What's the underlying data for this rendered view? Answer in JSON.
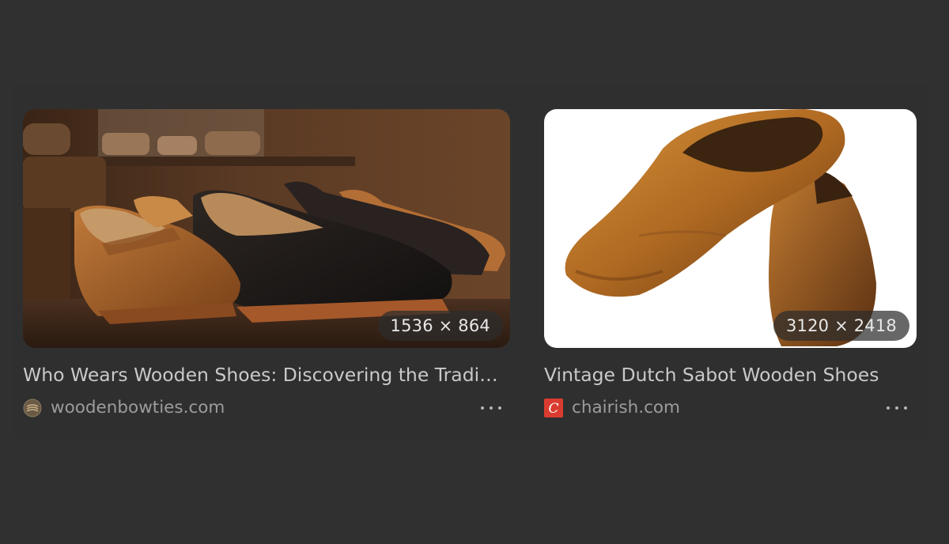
{
  "results": [
    {
      "title": "Who Wears Wooden Shoes: Discovering the Traditions",
      "dimensions": "1536 × 864",
      "source": "woodenbowties.com",
      "favicon": "woodenbowties-favicon-icon",
      "image": "wooden-clogs-row-on-shelf-image"
    },
    {
      "title": "Vintage Dutch Sabot Wooden Shoes",
      "dimensions": "3120 × 2418",
      "source": "chairish.com",
      "favicon": "chairish-logo-icon",
      "favicon_letter": "C",
      "favicon_color": "#d93c2f",
      "image": "pair-of-carved-wooden-sabots-image"
    }
  ],
  "more_icon": "more-options-icon",
  "colors": {
    "background": "#303030",
    "title_text": "#c9c9c9",
    "source_text": "#9c9c9c"
  }
}
